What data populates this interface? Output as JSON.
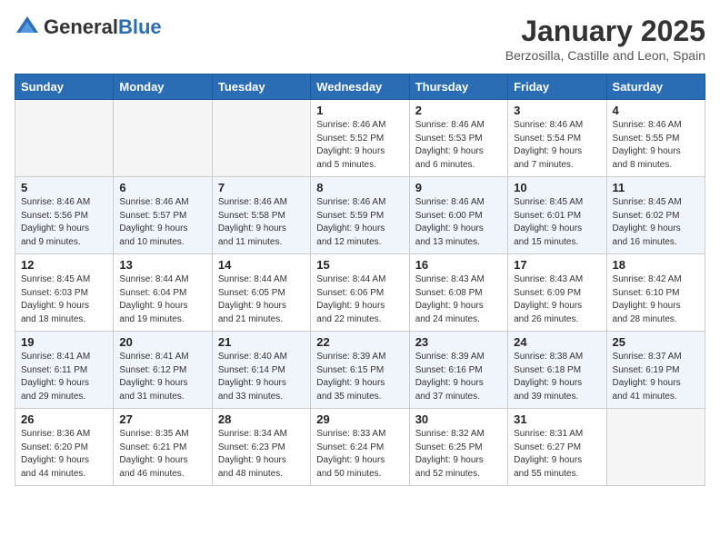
{
  "header": {
    "logo_general": "General",
    "logo_blue": "Blue",
    "month_year": "January 2025",
    "location": "Berzosilla, Castille and Leon, Spain"
  },
  "days_of_week": [
    "Sunday",
    "Monday",
    "Tuesday",
    "Wednesday",
    "Thursday",
    "Friday",
    "Saturday"
  ],
  "weeks": [
    {
      "alt": false,
      "days": [
        {
          "num": "",
          "info": "",
          "empty": true
        },
        {
          "num": "",
          "info": "",
          "empty": true
        },
        {
          "num": "",
          "info": "",
          "empty": true
        },
        {
          "num": "1",
          "info": "Sunrise: 8:46 AM\nSunset: 5:52 PM\nDaylight: 9 hours\nand 5 minutes.",
          "empty": false
        },
        {
          "num": "2",
          "info": "Sunrise: 8:46 AM\nSunset: 5:53 PM\nDaylight: 9 hours\nand 6 minutes.",
          "empty": false
        },
        {
          "num": "3",
          "info": "Sunrise: 8:46 AM\nSunset: 5:54 PM\nDaylight: 9 hours\nand 7 minutes.",
          "empty": false
        },
        {
          "num": "4",
          "info": "Sunrise: 8:46 AM\nSunset: 5:55 PM\nDaylight: 9 hours\nand 8 minutes.",
          "empty": false
        }
      ]
    },
    {
      "alt": true,
      "days": [
        {
          "num": "5",
          "info": "Sunrise: 8:46 AM\nSunset: 5:56 PM\nDaylight: 9 hours\nand 9 minutes.",
          "empty": false
        },
        {
          "num": "6",
          "info": "Sunrise: 8:46 AM\nSunset: 5:57 PM\nDaylight: 9 hours\nand 10 minutes.",
          "empty": false
        },
        {
          "num": "7",
          "info": "Sunrise: 8:46 AM\nSunset: 5:58 PM\nDaylight: 9 hours\nand 11 minutes.",
          "empty": false
        },
        {
          "num": "8",
          "info": "Sunrise: 8:46 AM\nSunset: 5:59 PM\nDaylight: 9 hours\nand 12 minutes.",
          "empty": false
        },
        {
          "num": "9",
          "info": "Sunrise: 8:46 AM\nSunset: 6:00 PM\nDaylight: 9 hours\nand 13 minutes.",
          "empty": false
        },
        {
          "num": "10",
          "info": "Sunrise: 8:45 AM\nSunset: 6:01 PM\nDaylight: 9 hours\nand 15 minutes.",
          "empty": false
        },
        {
          "num": "11",
          "info": "Sunrise: 8:45 AM\nSunset: 6:02 PM\nDaylight: 9 hours\nand 16 minutes.",
          "empty": false
        }
      ]
    },
    {
      "alt": false,
      "days": [
        {
          "num": "12",
          "info": "Sunrise: 8:45 AM\nSunset: 6:03 PM\nDaylight: 9 hours\nand 18 minutes.",
          "empty": false
        },
        {
          "num": "13",
          "info": "Sunrise: 8:44 AM\nSunset: 6:04 PM\nDaylight: 9 hours\nand 19 minutes.",
          "empty": false
        },
        {
          "num": "14",
          "info": "Sunrise: 8:44 AM\nSunset: 6:05 PM\nDaylight: 9 hours\nand 21 minutes.",
          "empty": false
        },
        {
          "num": "15",
          "info": "Sunrise: 8:44 AM\nSunset: 6:06 PM\nDaylight: 9 hours\nand 22 minutes.",
          "empty": false
        },
        {
          "num": "16",
          "info": "Sunrise: 8:43 AM\nSunset: 6:08 PM\nDaylight: 9 hours\nand 24 minutes.",
          "empty": false
        },
        {
          "num": "17",
          "info": "Sunrise: 8:43 AM\nSunset: 6:09 PM\nDaylight: 9 hours\nand 26 minutes.",
          "empty": false
        },
        {
          "num": "18",
          "info": "Sunrise: 8:42 AM\nSunset: 6:10 PM\nDaylight: 9 hours\nand 28 minutes.",
          "empty": false
        }
      ]
    },
    {
      "alt": true,
      "days": [
        {
          "num": "19",
          "info": "Sunrise: 8:41 AM\nSunset: 6:11 PM\nDaylight: 9 hours\nand 29 minutes.",
          "empty": false
        },
        {
          "num": "20",
          "info": "Sunrise: 8:41 AM\nSunset: 6:12 PM\nDaylight: 9 hours\nand 31 minutes.",
          "empty": false
        },
        {
          "num": "21",
          "info": "Sunrise: 8:40 AM\nSunset: 6:14 PM\nDaylight: 9 hours\nand 33 minutes.",
          "empty": false
        },
        {
          "num": "22",
          "info": "Sunrise: 8:39 AM\nSunset: 6:15 PM\nDaylight: 9 hours\nand 35 minutes.",
          "empty": false
        },
        {
          "num": "23",
          "info": "Sunrise: 8:39 AM\nSunset: 6:16 PM\nDaylight: 9 hours\nand 37 minutes.",
          "empty": false
        },
        {
          "num": "24",
          "info": "Sunrise: 8:38 AM\nSunset: 6:18 PM\nDaylight: 9 hours\nand 39 minutes.",
          "empty": false
        },
        {
          "num": "25",
          "info": "Sunrise: 8:37 AM\nSunset: 6:19 PM\nDaylight: 9 hours\nand 41 minutes.",
          "empty": false
        }
      ]
    },
    {
      "alt": false,
      "days": [
        {
          "num": "26",
          "info": "Sunrise: 8:36 AM\nSunset: 6:20 PM\nDaylight: 9 hours\nand 44 minutes.",
          "empty": false
        },
        {
          "num": "27",
          "info": "Sunrise: 8:35 AM\nSunset: 6:21 PM\nDaylight: 9 hours\nand 46 minutes.",
          "empty": false
        },
        {
          "num": "28",
          "info": "Sunrise: 8:34 AM\nSunset: 6:23 PM\nDaylight: 9 hours\nand 48 minutes.",
          "empty": false
        },
        {
          "num": "29",
          "info": "Sunrise: 8:33 AM\nSunset: 6:24 PM\nDaylight: 9 hours\nand 50 minutes.",
          "empty": false
        },
        {
          "num": "30",
          "info": "Sunrise: 8:32 AM\nSunset: 6:25 PM\nDaylight: 9 hours\nand 52 minutes.",
          "empty": false
        },
        {
          "num": "31",
          "info": "Sunrise: 8:31 AM\nSunset: 6:27 PM\nDaylight: 9 hours\nand 55 minutes.",
          "empty": false
        },
        {
          "num": "",
          "info": "",
          "empty": true
        }
      ]
    }
  ]
}
